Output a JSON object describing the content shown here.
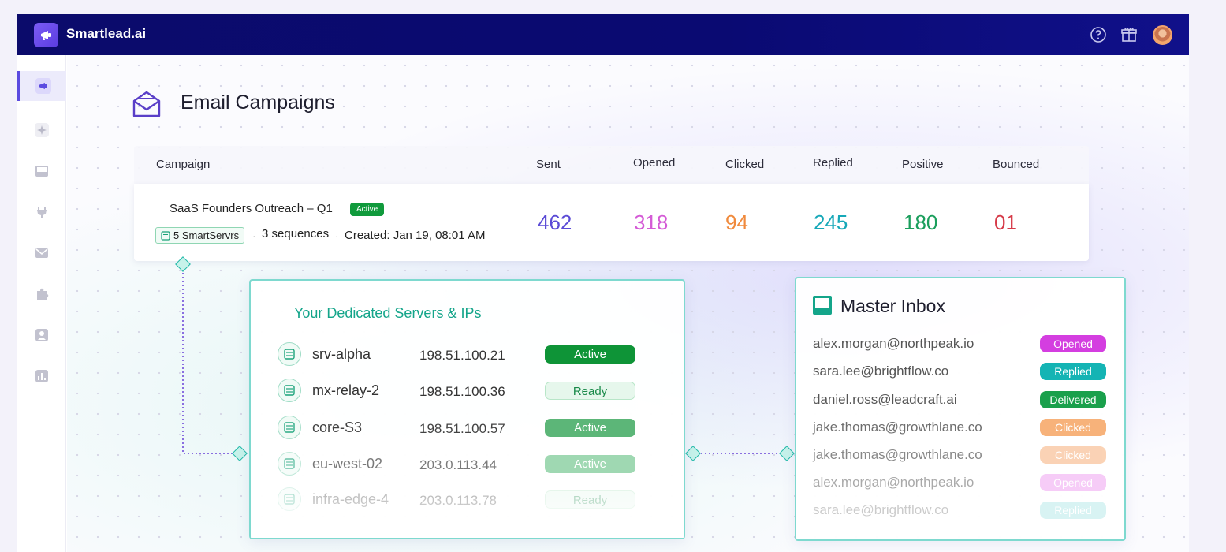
{
  "app": {
    "brand": "Smartlead.ai"
  },
  "sidebar": {
    "items": [
      {
        "icon": "megaphone-icon",
        "active": true
      },
      {
        "icon": "sparkle-icon",
        "active": false
      },
      {
        "icon": "inbox-icon",
        "active": false
      },
      {
        "icon": "plug-icon",
        "active": false
      },
      {
        "icon": "envelope-icon",
        "active": false
      },
      {
        "icon": "puzzle-icon",
        "active": false
      },
      {
        "icon": "user-icon",
        "active": false
      },
      {
        "icon": "bar-chart-icon",
        "active": false
      }
    ]
  },
  "page": {
    "title": "Email Campaigns"
  },
  "table": {
    "headers": {
      "campaign": "Campaign",
      "sent": "Sent",
      "opened": "Opened",
      "clicked": "Clicked",
      "replied": "Replied",
      "positive": "Positive",
      "bounced": "Bounced"
    },
    "row": {
      "name": "SaaS Founders Outreach – Q1",
      "status": "Active",
      "servers": "5 SmartServrs",
      "sequences": "3 sequences",
      "created": "Created: Jan 19, 08:01 AM",
      "sent": "462",
      "opened": "318",
      "clicked": "94",
      "replied": "245",
      "positive": "180",
      "bounced": "01"
    }
  },
  "servers_panel": {
    "title": "Your Dedicated Servers & IPs",
    "rows": [
      {
        "name": "srv-alpha",
        "ip": "198.51.100.21",
        "status": "Active"
      },
      {
        "name": "mx-relay-2",
        "ip": "198.51.100.36",
        "status": "Ready"
      },
      {
        "name": "core-S3",
        "ip": "198.51.100.57",
        "status": "Active"
      },
      {
        "name": "eu-west-02",
        "ip": "203.0.113.44",
        "status": "Active"
      },
      {
        "name": "infra-edge-4",
        "ip": "203.0.113.78",
        "status": "Ready"
      }
    ]
  },
  "inbox_panel": {
    "title": "Master Inbox",
    "rows": [
      {
        "email": "alex.morgan@northpeak.io",
        "status": "Opened"
      },
      {
        "email": "sara.lee@brightflow.co",
        "status": "Replied"
      },
      {
        "email": "daniel.ross@leadcraft.ai",
        "status": "Delivered"
      },
      {
        "email": "jake.thomas@growthlane.co",
        "status": "Clicked"
      },
      {
        "email": "jake.thomas@growthlane.co",
        "status": "Clicked"
      },
      {
        "email": "alex.morgan@northpeak.io",
        "status": "Opened"
      },
      {
        "email": "sara.lee@brightflow.co",
        "status": "Replied"
      }
    ]
  },
  "colors": {
    "topbar": "#0b0b6b",
    "accent": "#5b4be0",
    "sent": "#5b4bd6",
    "opened": "#d45ad6",
    "clicked": "#f08a3c",
    "replied": "#16a8b8",
    "positive": "#1a9e5c",
    "bounced": "#d63a48"
  }
}
